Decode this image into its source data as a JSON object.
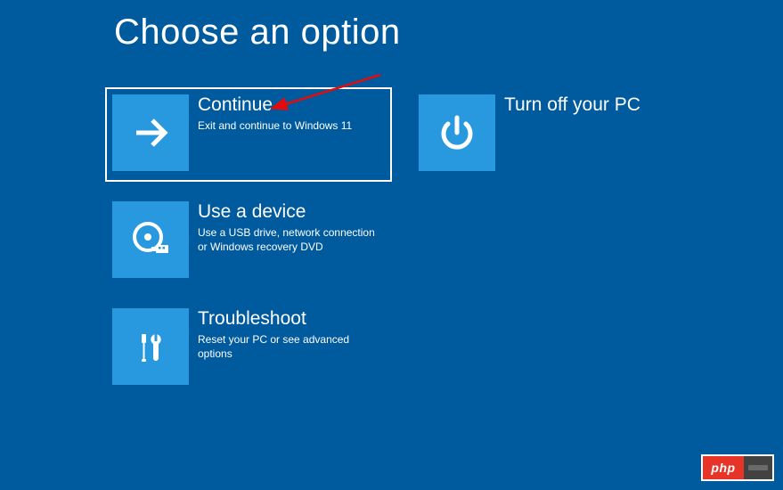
{
  "title": "Choose an option",
  "options": {
    "continue": {
      "title": "Continue",
      "desc": "Exit and continue to Windows 11"
    },
    "turn_off": {
      "title": "Turn off your PC",
      "desc": ""
    },
    "use_device": {
      "title": "Use a device",
      "desc": "Use a USB drive, network connection or Windows recovery DVD"
    },
    "troubleshoot": {
      "title": "Troubleshoot",
      "desc": "Reset your PC or see advanced options"
    }
  },
  "watermark": {
    "brand": "php"
  }
}
